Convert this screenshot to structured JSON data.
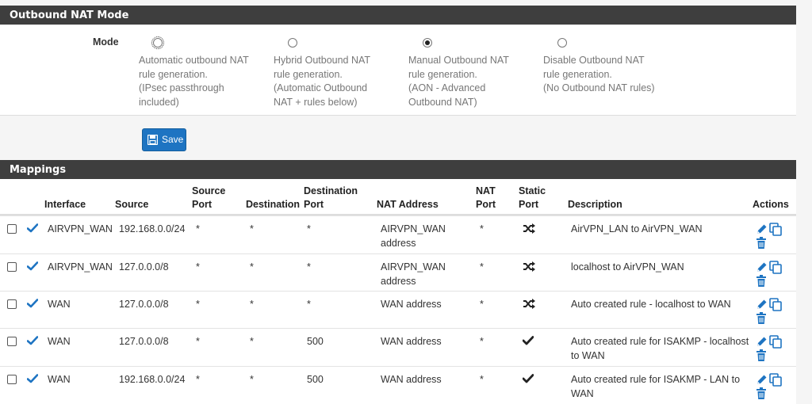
{
  "nat_mode": {
    "heading": "Outbound NAT Mode",
    "mode_label": "Mode",
    "options": [
      {
        "lines": [
          "Automatic outbound NAT",
          "rule generation.",
          "(IPsec passthrough",
          "included)"
        ],
        "checked": false
      },
      {
        "lines": [
          "Hybrid Outbound NAT",
          "rule generation.",
          "(Automatic Outbound",
          "NAT + rules below)"
        ],
        "checked": false
      },
      {
        "lines": [
          "Manual Outbound NAT",
          "rule generation.",
          "(AON - Advanced",
          "Outbound NAT)"
        ],
        "checked": true
      },
      {
        "lines": [
          "Disable Outbound NAT",
          "rule generation.",
          "(No Outbound NAT rules)"
        ],
        "checked": false
      }
    ],
    "save_label": "Save"
  },
  "mappings": {
    "heading": "Mappings",
    "headers": {
      "interface": "Interface",
      "source": "Source",
      "source_port": [
        "Source",
        "Port"
      ],
      "destination": "Destination",
      "destination_port": [
        "Destination",
        "Port"
      ],
      "nat_address": "NAT Address",
      "nat_port": [
        "NAT",
        "Port"
      ],
      "static_port": [
        "Static",
        "Port"
      ],
      "description": "Description",
      "actions": "Actions"
    },
    "rows": [
      {
        "interface": "AIRVPN_WAN",
        "source": "192.168.0.0/24",
        "source_port": "*",
        "destination": "*",
        "destination_port": "*",
        "nat_address": [
          "AIRVPN_WAN",
          "address"
        ],
        "nat_port": "*",
        "static_port": "shuffle-icon",
        "description": [
          "AirVPN_LAN to AirVPN_WAN"
        ]
      },
      {
        "interface": "AIRVPN_WAN",
        "source": "127.0.0.0/8",
        "source_port": "*",
        "destination": "*",
        "destination_port": "*",
        "nat_address": [
          "AIRVPN_WAN",
          "address"
        ],
        "nat_port": "*",
        "static_port": "shuffle-icon",
        "description": [
          "localhost to AirVPN_WAN"
        ]
      },
      {
        "interface": "WAN",
        "source": "127.0.0.0/8",
        "source_port": "*",
        "destination": "*",
        "destination_port": "*",
        "nat_address": [
          "WAN address"
        ],
        "nat_port": "*",
        "static_port": "shuffle-icon",
        "description": [
          "Auto created rule - localhost to WAN"
        ]
      },
      {
        "interface": "WAN",
        "source": "127.0.0.0/8",
        "source_port": "*",
        "destination": "*",
        "destination_port": "500",
        "nat_address": [
          "WAN address"
        ],
        "nat_port": "*",
        "static_port": "checkmark-icon",
        "description": [
          "Auto created rule for ISAKMP - localhost",
          "to WAN"
        ]
      },
      {
        "interface": "WAN",
        "source": "192.168.0.0/24",
        "source_port": "*",
        "destination": "*",
        "destination_port": "500",
        "nat_address": [
          "WAN address"
        ],
        "nat_port": "*",
        "static_port": "checkmark-icon",
        "description": [
          "Auto created rule for ISAKMP - LAN to",
          "WAN"
        ]
      }
    ]
  },
  "colors": {
    "header_bg": "#3e3e3e",
    "button_bg": "#1e74c2",
    "icon_blue": "#1e74c2"
  }
}
